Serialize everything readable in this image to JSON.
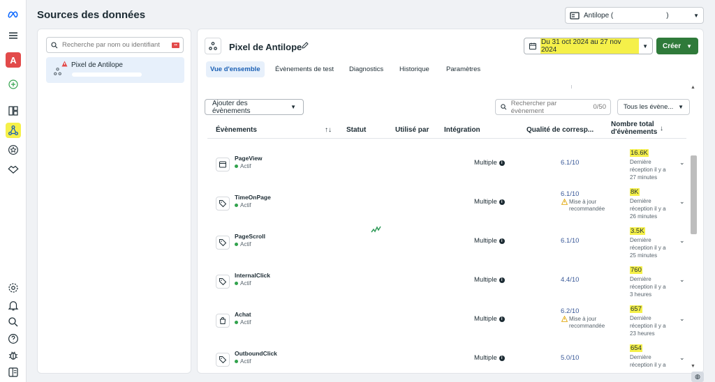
{
  "page": {
    "title": "Sources des données"
  },
  "account": {
    "label": "Antilope (",
    "suffix": ")"
  },
  "sidebar_rail": {
    "icons": [
      "meta-logo-icon",
      "menu-icon",
      "account-avatar-icon",
      "add-icon",
      "grid-icon",
      "events-manager-icon",
      "star-icon",
      "handshake-icon",
      "settings-icon",
      "bell-icon",
      "search-icon",
      "help-icon",
      "bug-icon",
      "panel-icon"
    ],
    "account_initial": "A"
  },
  "left_panel": {
    "search_placeholder": "Recherche par nom ou identifiant",
    "selected_pixel": "Pixel de Antilope"
  },
  "main": {
    "title": "Pixel de Antilope",
    "date_range": "Du 31 oct 2024 au 27 nov 2024",
    "create_label": "Créer",
    "tabs": [
      {
        "label": "Vue d'ensemble",
        "active": true
      },
      {
        "label": "Évènements de test",
        "active": false
      },
      {
        "label": "Diagnostics",
        "active": false
      },
      {
        "label": "Historique",
        "active": false
      },
      {
        "label": "Paramètres",
        "active": false
      }
    ],
    "add_events_label": "Ajouter des évènements",
    "event_search_placeholder": "Rechercher par évènement",
    "event_search_count": "0/50",
    "filter_label": "Tous les évène...",
    "columns": {
      "events": "Évènements",
      "status": "Statut",
      "used_by": "Utilisé par",
      "integration": "Intégration",
      "quality": "Qualité de corresp...",
      "total_1": "Nombre total",
      "total_2": "d'évènements"
    },
    "rows": [
      {
        "name": "PageView",
        "status": "Actif",
        "integration": "Multiple",
        "quality": "6.1/10",
        "rec1": "",
        "rec2": "",
        "count": "16.6K",
        "last1": "Dernière",
        "last2": "réception il y a",
        "last3": "27 minutes",
        "icon": "page-icon"
      },
      {
        "name": "TimeOnPage",
        "status": "Actif",
        "integration": "Multiple",
        "quality": "6.1/10",
        "rec1": "Mise à jour",
        "rec2": "recommandée",
        "count": "8K",
        "last1": "Dernière",
        "last2": "réception il y a",
        "last3": "26 minutes",
        "icon": "tag-icon"
      },
      {
        "name": "PageScroll",
        "status": "Actif",
        "integration": "Multiple",
        "quality": "6.1/10",
        "rec1": "",
        "rec2": "",
        "count": "3.5K",
        "last1": "Dernière",
        "last2": "réception il y a",
        "last3": "25 minutes",
        "icon": "tag-icon"
      },
      {
        "name": "InternalClick",
        "status": "Actif",
        "integration": "Multiple",
        "quality": "4.4/10",
        "rec1": "",
        "rec2": "",
        "count": "760",
        "last1": "Dernière",
        "last2": "réception il y a",
        "last3": "3 heures",
        "icon": "tag-icon"
      },
      {
        "name": "Achat",
        "status": "Actif",
        "integration": "Multiple",
        "quality": "6.2/10",
        "rec1": "Mise à jour",
        "rec2": "recommandée",
        "count": "657",
        "last1": "Dernière",
        "last2": "réception il y a",
        "last3": "23 heures",
        "icon": "bag-icon"
      },
      {
        "name": "OutboundClick",
        "status": "Actif",
        "integration": "Multiple",
        "quality": "5.0/10",
        "rec1": "",
        "rec2": "",
        "count": "654",
        "last1": "Dernière",
        "last2": "réception il y a",
        "last3": "",
        "icon": "tag-icon"
      }
    ]
  },
  "colors": {
    "highlight": "#f5f049",
    "create_button": "#2f7a3a",
    "active_tab": "#e7f0fb",
    "status_active": "#31a24c"
  }
}
